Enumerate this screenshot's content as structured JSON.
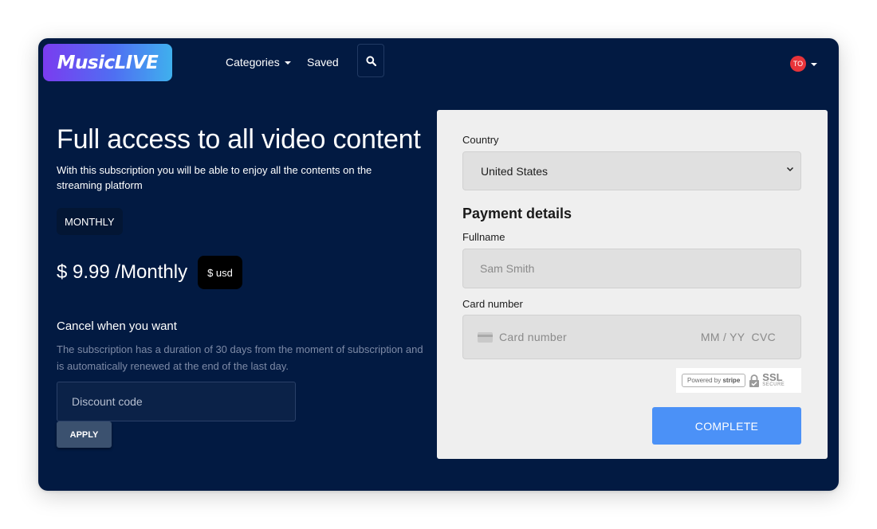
{
  "nav": {
    "logo": "MusicLIVE",
    "categories": "Categories",
    "saved": "Saved",
    "avatar_initials": "TO"
  },
  "offer": {
    "title": "Full access to all video content",
    "subtitle": "With this subscription you will be able to enjoy all the contents on the streaming platform",
    "plan": "MONTHLY",
    "price": "$ 9.99 /Monthly",
    "currency": "$ usd",
    "cancel_title": "Cancel when you want",
    "cancel_desc": "The subscription has a duration of 30 days from the moment of subscription and is automatically renewed at the end of the last day.",
    "discount_placeholder": "Discount code",
    "apply_label": "APPLY"
  },
  "payment": {
    "country_label": "Country",
    "country_value": "United States",
    "title": "Payment details",
    "fullname_label": "Fullname",
    "fullname_placeholder": "Sam Smith",
    "card_label": "Card number",
    "card_placeholder": "Card number",
    "card_expiry_cvc": "MM / YY  CVC",
    "powered_by": "Powered by",
    "stripe": "stripe",
    "ssl": "SSL",
    "ssl_secure": "SECURE",
    "complete_label": "COMPLETE"
  },
  "colors": {
    "background": "#021a42",
    "accent": "#4b91f7",
    "avatar": "#e8343a"
  }
}
